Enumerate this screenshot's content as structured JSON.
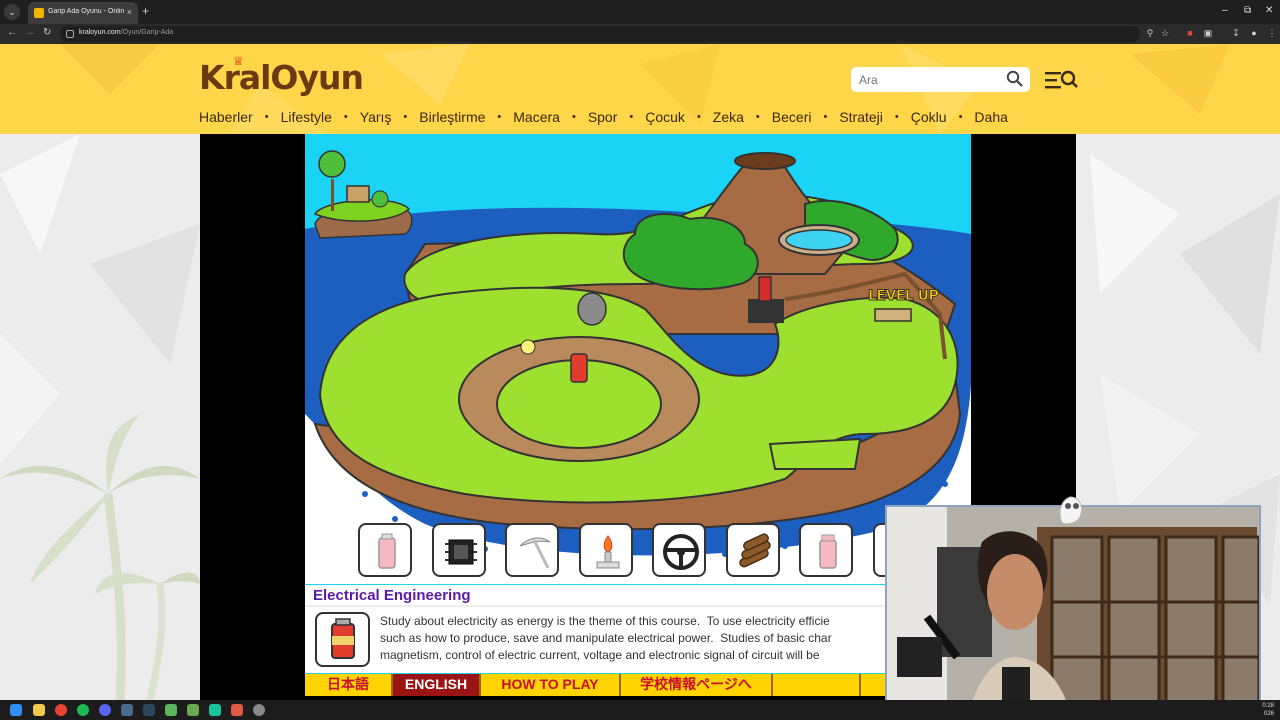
{
  "browser": {
    "tab_title": "Garip Ada Oyunu - Online ücre",
    "url_domain": "kraloyun.com",
    "url_path": "/Oyun/Garip-Ada",
    "tab_menu": "⌄",
    "tab_close": "×",
    "new_tab": "+",
    "window_minimize": "–",
    "window_restore": "⧉",
    "window_close": "✕"
  },
  "site": {
    "logo_text": "KralOyun",
    "search_placeholder": "Ara",
    "nav_items": [
      "Haberler",
      "Lifestyle",
      "Yarış",
      "Birleştirme",
      "Macera",
      "Spor",
      "Çocuk",
      "Zeka",
      "Beceri",
      "Strateji",
      "Çoklu",
      "Daha"
    ],
    "nav_separator": "•",
    "accent_color": "#ffd54a"
  },
  "game": {
    "level_up_label": "LEVEL UP",
    "tools": [
      "battery-icon",
      "chip-icon",
      "pickaxe-icon",
      "bunsen-burner-icon",
      "steering-wheel-icon",
      "logs-icon",
      "canister-icon"
    ],
    "course_title": "Electrical Engineering",
    "description_lines": [
      "Study about electricity as energy is the theme of this course.  To use electricity efficie",
      "such as how to produce, save and manipulate electrical power.  Studies of basic char",
      "magnetism, control of electric current, voltage and electronic signal of circuit will be"
    ],
    "language_buttons": [
      {
        "label": "日本語",
        "active": false
      },
      {
        "label": "ENGLISH",
        "active": true
      },
      {
        "label": "HOW TO PLAY",
        "active": false
      },
      {
        "label": "学校情報ページへ",
        "active": false
      },
      {
        "label": "",
        "active": false
      },
      {
        "label": "",
        "active": false
      }
    ]
  },
  "taskbar": {
    "time": "0:28",
    "date": "026"
  }
}
